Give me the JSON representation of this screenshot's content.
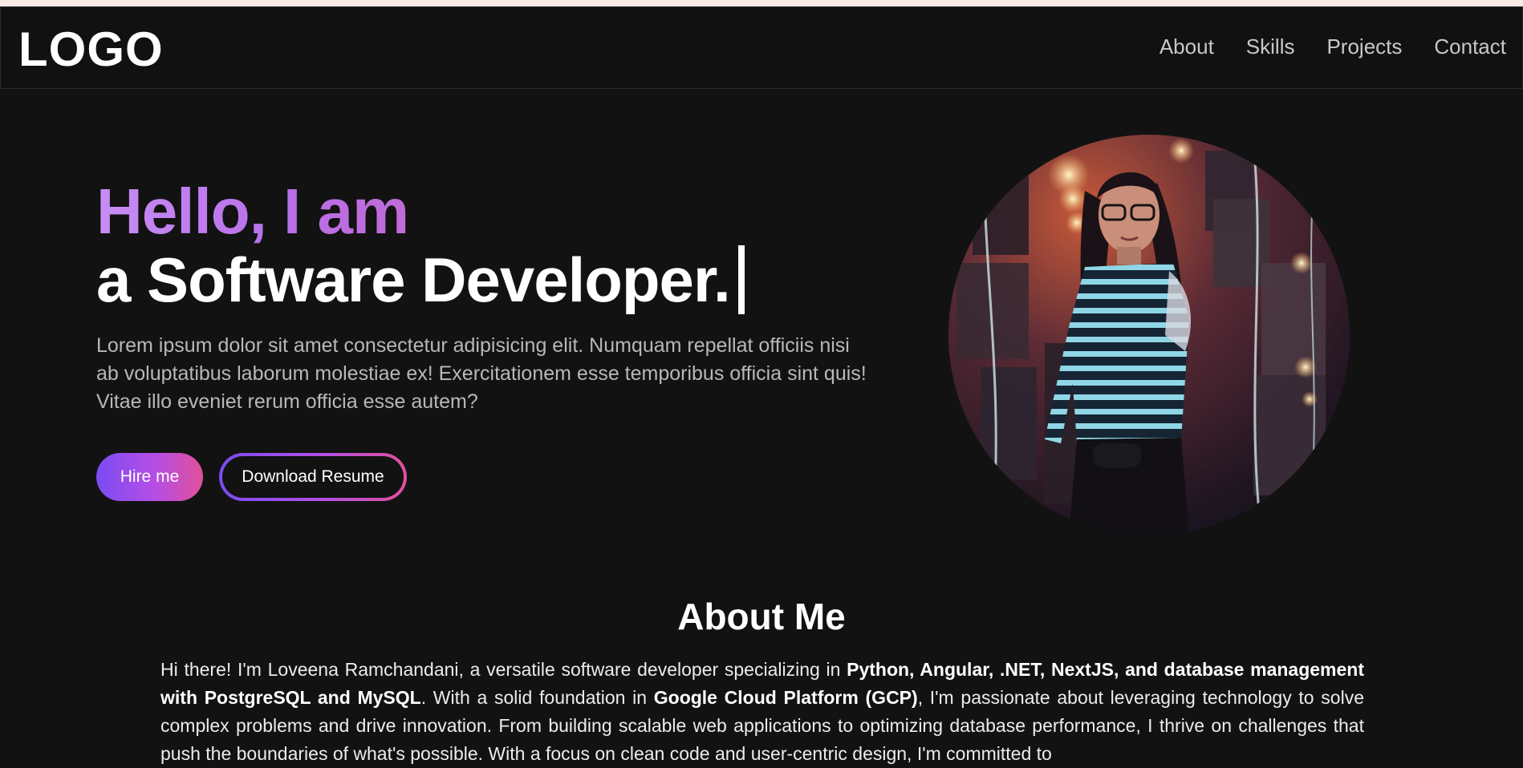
{
  "header": {
    "logo": "LOGO",
    "nav": [
      {
        "label": "About"
      },
      {
        "label": "Skills"
      },
      {
        "label": "Projects"
      },
      {
        "label": "Contact"
      }
    ]
  },
  "hero": {
    "greeting": "Hello, I am",
    "role": "a Software Developer.",
    "description": "Lorem ipsum dolor sit amet consectetur adipisicing elit. Numquam repellat officiis nisi ab voluptatibus laborum molestiae ex! Exercitationem esse temporibus officia sint quis! Vitae illo eveniet rerum officia esse autem?",
    "hire_button": "Hire me",
    "resume_button": "Download Resume"
  },
  "about": {
    "title": "About Me",
    "p1": "Hi there! I'm Loveena Ramchandani, a versatile software developer specializing in ",
    "b1": "Python, Angular, .NET, NextJS, and database management with PostgreSQL and MySQL",
    "p2": ". With a solid foundation in ",
    "b2": "Google Cloud Platform (GCP)",
    "p3": ", I'm passionate about leveraging technology to solve complex problems and drive innovation. From building scalable web applications to optimizing database performance, I thrive on challenges that push the boundaries of what's possible. With a focus on clean code and user-centric design, I'm committed to"
  },
  "colors": {
    "background": "#121212",
    "accent_start": "#7a4cf2",
    "accent_mid": "#b64ee6",
    "accent_end": "#e0509a",
    "greeting": "#c88df5"
  }
}
